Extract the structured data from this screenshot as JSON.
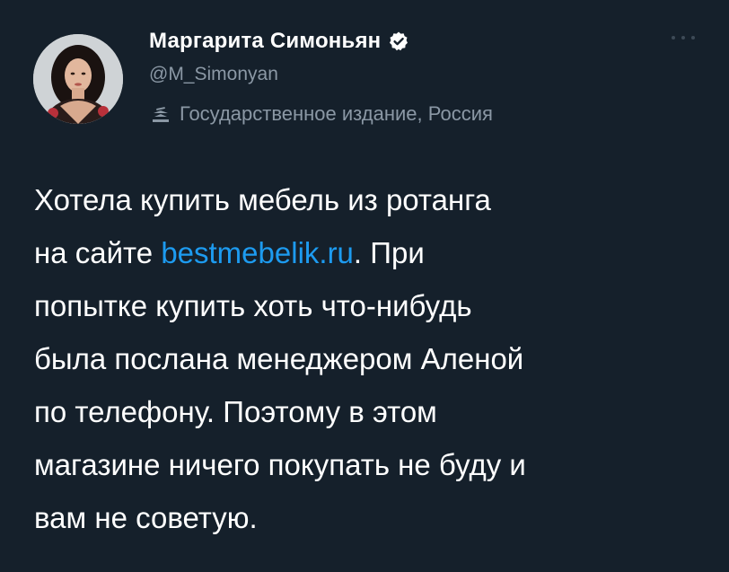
{
  "author": {
    "display_name": "Маргарита Симоньян",
    "handle": "@M_Simonyan",
    "affiliation": "Государственное издание, Россия",
    "verified": true,
    "avatar_icon": "profile-photo"
  },
  "icons": {
    "verified": "verified-badge-icon",
    "affiliation": "state-media-icon",
    "more": "more-options-icon"
  },
  "tweet": {
    "lines": [
      {
        "before": "Хотела купить мебель из ротанга",
        "link": "",
        "after": ""
      },
      {
        "before": "на сайте ",
        "link": "bestmebelik.ru",
        "after": ". При"
      },
      {
        "before": "попытке купить хоть что-нибудь",
        "link": "",
        "after": ""
      },
      {
        "before": "была послана менеджером Аленой",
        "link": "",
        "after": ""
      },
      {
        "before": "по телефону. Поэтому в этом",
        "link": "",
        "after": ""
      },
      {
        "before": "магазине ничего покупать не буду и",
        "link": "",
        "after": ""
      },
      {
        "before": "вам не советую.",
        "link": "",
        "after": ""
      }
    ]
  },
  "colors": {
    "background": "#15202b",
    "text": "#ffffff",
    "secondary": "#8b98a5",
    "link": "#1d9bf0"
  }
}
